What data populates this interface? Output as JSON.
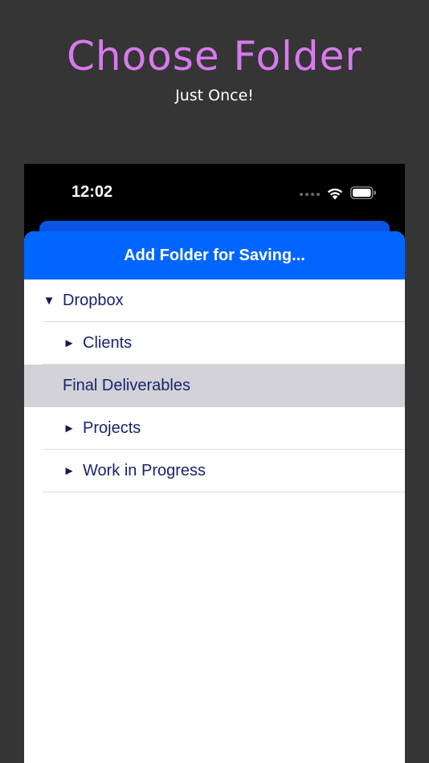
{
  "promo": {
    "title": "Choose Folder",
    "subtitle": "Just Once!"
  },
  "status_bar": {
    "time": "12:02",
    "icons": [
      "cellular-dots-icon",
      "wifi-icon",
      "battery-icon"
    ]
  },
  "sheet": {
    "header_label": "Add Folder for Saving...",
    "header_color": "#0066ff"
  },
  "tree": {
    "items": [
      {
        "label": "Dropbox",
        "expander": "▼",
        "level": 0,
        "expanded": true
      },
      {
        "label": "Clients",
        "expander": "►",
        "level": 1,
        "expanded": false
      },
      {
        "label": "Final Deliverables",
        "expander": "",
        "level": 1,
        "selected": true
      },
      {
        "label": "Projects",
        "expander": "►",
        "level": 1,
        "expanded": false
      },
      {
        "label": "Work in Progress",
        "expander": "►",
        "level": 1,
        "expanded": false
      }
    ]
  },
  "colors": {
    "background": "#353535",
    "title": "#d879ee",
    "accent": "#0066ff",
    "text": "#1a2370",
    "selected_row": "#d2d2d7"
  }
}
